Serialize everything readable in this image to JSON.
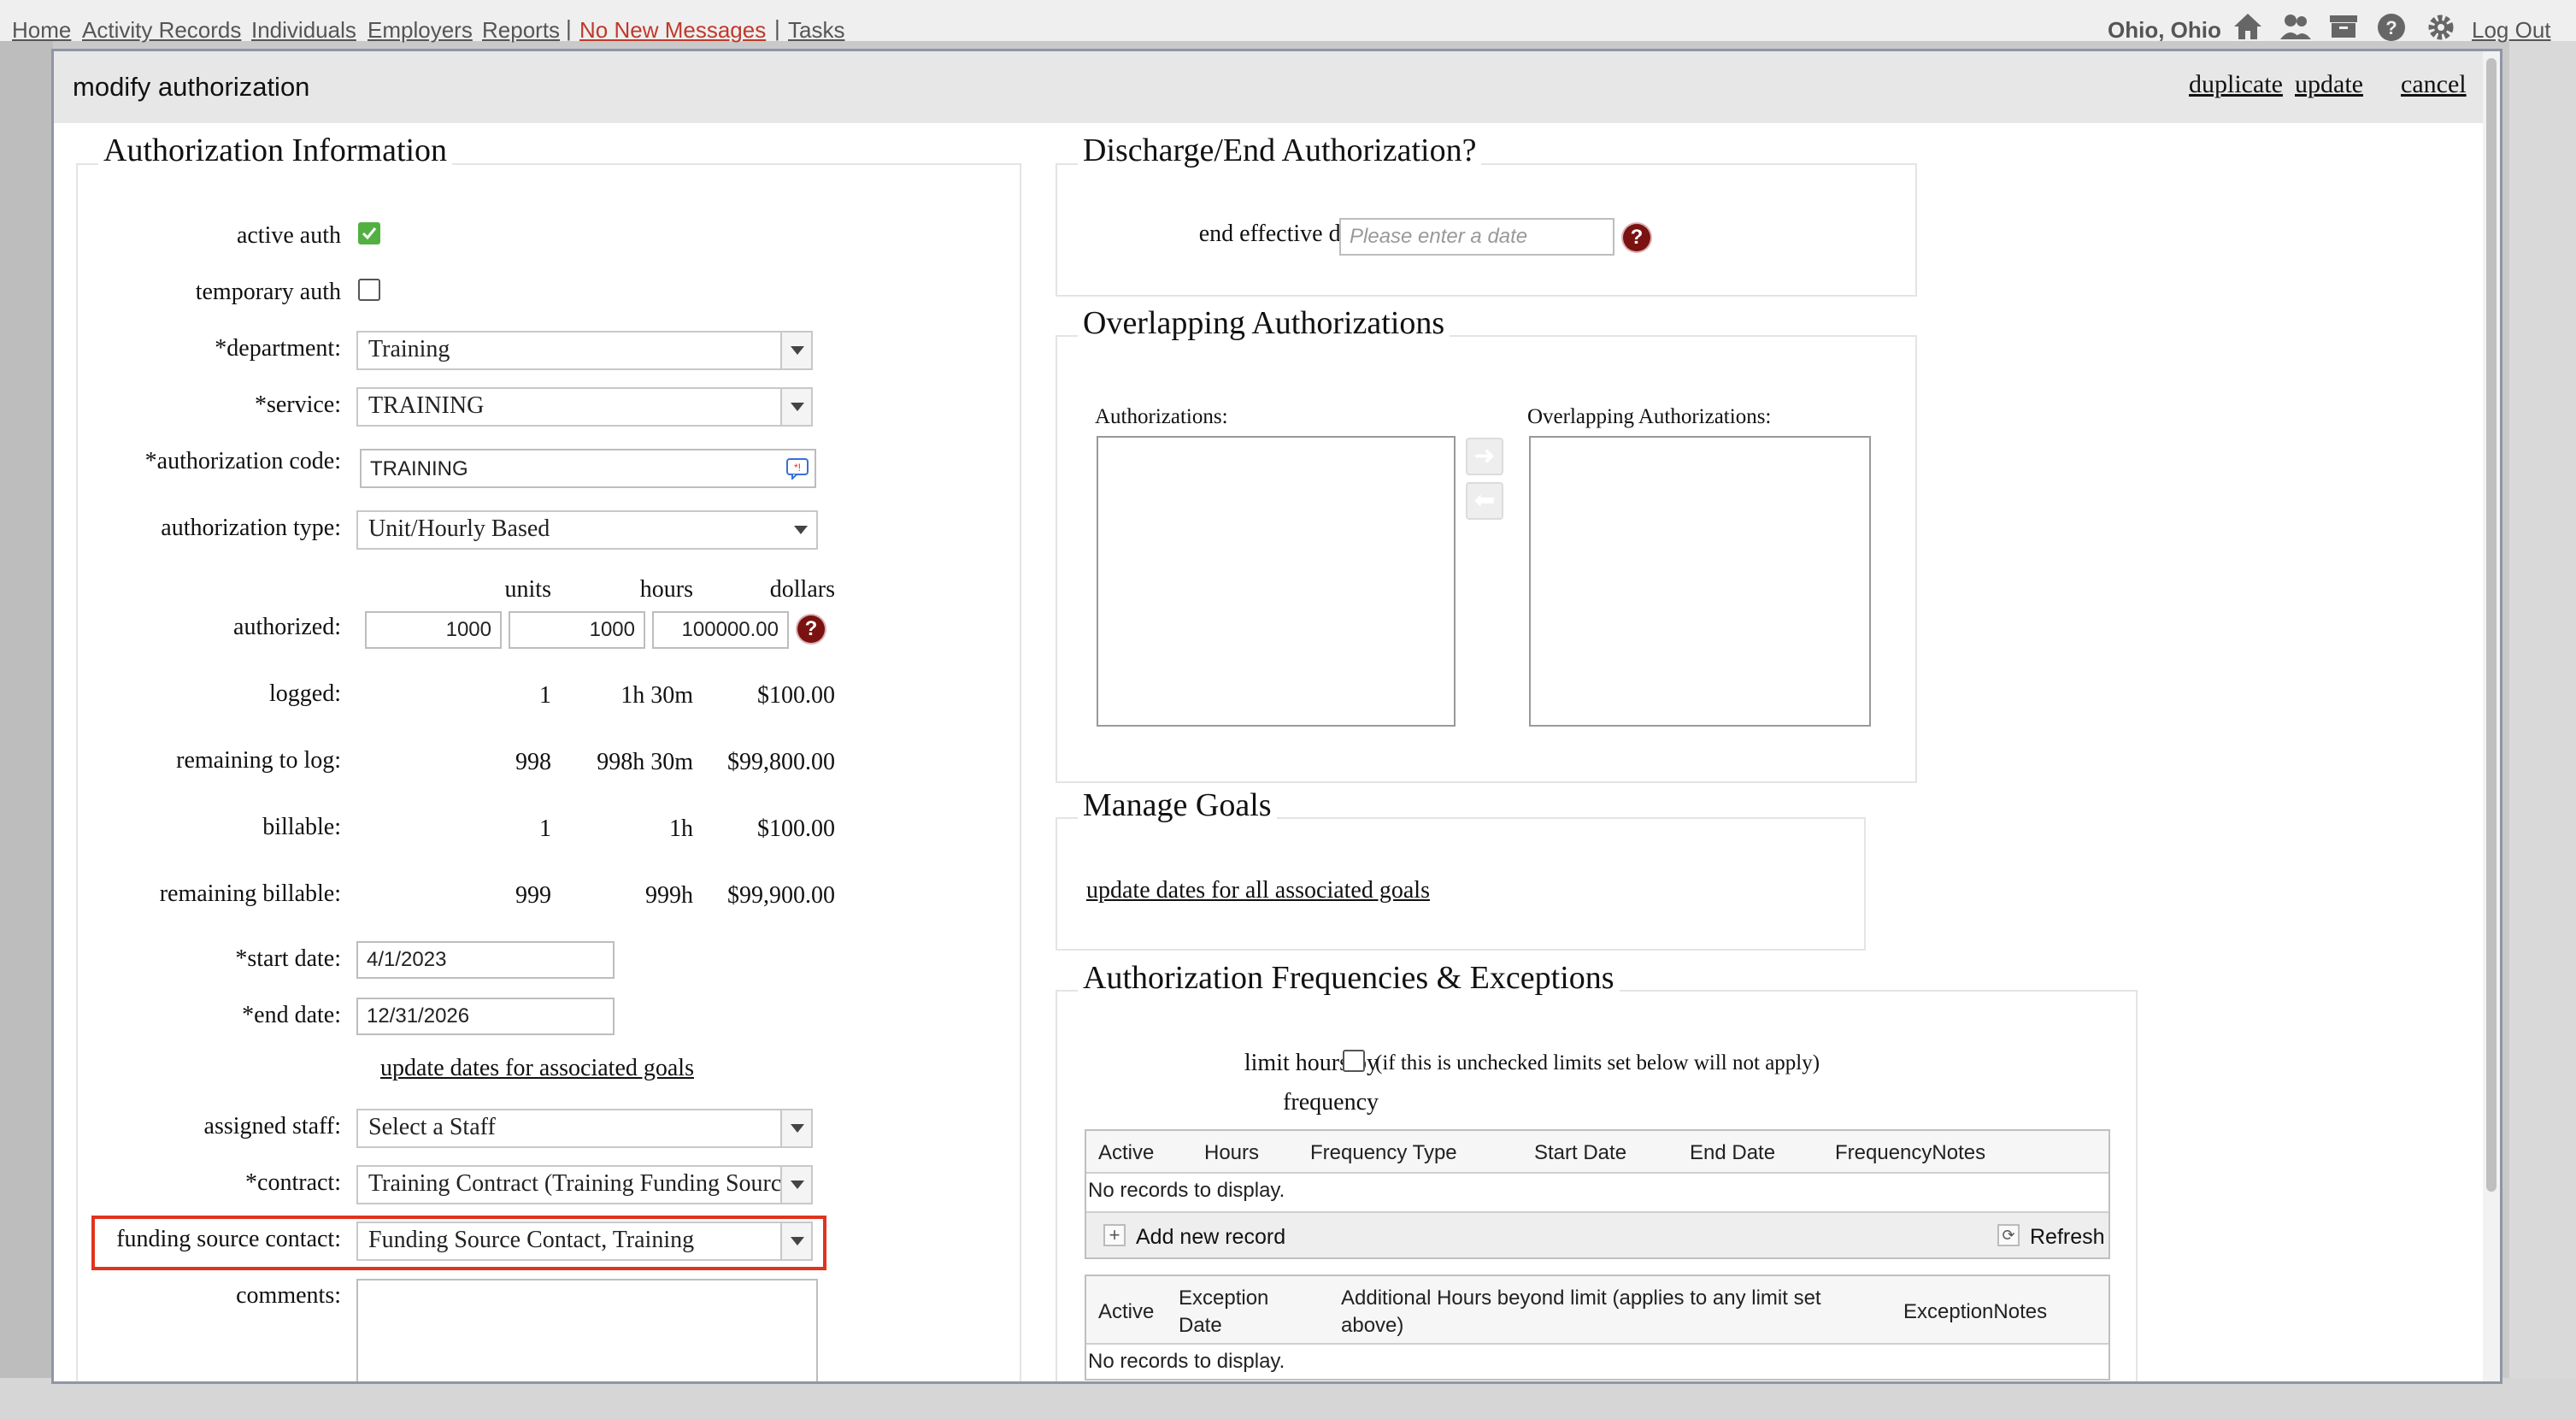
{
  "nav": {
    "items": [
      "Home",
      "Activity Records",
      "Individuals",
      "Employers",
      "Reports"
    ],
    "messages": "No New Messages",
    "tasks": "Tasks",
    "location": "Ohio, Ohio",
    "logout": "Log Out",
    "icons": [
      "home-icon",
      "users-icon",
      "archive-icon",
      "help-icon",
      "gear-icon"
    ],
    "accent_color": "#c0392b"
  },
  "modal": {
    "title": "modify authorization",
    "actions": {
      "duplicate": "duplicate",
      "update": "update",
      "cancel": "cancel"
    }
  },
  "auth_info": {
    "title": "Authorization Information",
    "active_auth": {
      "label": "active auth",
      "checked": true
    },
    "temporary_auth": {
      "label": "temporary auth",
      "checked": false
    },
    "department": {
      "label": "*department:",
      "value": "Training"
    },
    "service": {
      "label": "*service:",
      "value": "TRAINING"
    },
    "authorization_code": {
      "label": "*authorization code:",
      "value": "TRAINING"
    },
    "authorization_type": {
      "label": "authorization type:",
      "value": "Unit/Hourly Based"
    },
    "columns": [
      "units",
      "hours",
      "dollars"
    ],
    "authorized": {
      "label": "authorized:",
      "units": "1000",
      "hours": "1000",
      "dollars": "100000.00"
    },
    "logged": {
      "label": "logged:",
      "units": "1",
      "hours": "1h 30m",
      "dollars": "$100.00"
    },
    "remaining_to_log": {
      "label": "remaining to log:",
      "units": "998",
      "hours": "998h 30m",
      "dollars": "$99,800.00"
    },
    "billable": {
      "label": "billable:",
      "units": "1",
      "hours": "1h",
      "dollars": "$100.00"
    },
    "remaining_billable": {
      "label": "remaining billable:",
      "units": "999",
      "hours": "999h",
      "dollars": "$99,900.00"
    },
    "start_date": {
      "label": "*start date:",
      "value": "4/1/2023"
    },
    "end_date": {
      "label": "*end date:",
      "value": "12/31/2026"
    },
    "update_goals_link": "update dates for associated goals",
    "assigned_staff": {
      "label": "assigned staff:",
      "value": "Select a Staff"
    },
    "contract": {
      "label": "*contract:",
      "value": "Training Contract (Training Funding Source)"
    },
    "funding_source_contact": {
      "label": "funding source contact:",
      "value": "Funding Source Contact, Training"
    },
    "comments": {
      "label": "comments:",
      "value": ""
    }
  },
  "discharge": {
    "title": "Discharge/End Authorization?",
    "end_effective_label": "end effective date:",
    "end_effective_placeholder": "Please enter a date"
  },
  "overlapping": {
    "title": "Overlapping Authorizations",
    "left_label": "Authorizations:",
    "right_label": "Overlapping Authorizations:",
    "move_right": "➜",
    "move_left": "⬅"
  },
  "goals": {
    "title": "Manage Goals",
    "link": "update dates for all associated goals"
  },
  "frequencies": {
    "title": "Authorization Frequencies & Exceptions",
    "limit_label": "limit hours by",
    "limit_label_2": "frequency",
    "limit_note": "(if this is unchecked limits set below will not apply)",
    "limit_checked": false,
    "freq_grid": {
      "headers": [
        "Active",
        "Hours",
        "Frequency Type",
        "Start Date",
        "End Date",
        "FrequencyNotes"
      ],
      "empty": "No records to display.",
      "add_label": "Add new record",
      "refresh_label": "Refresh"
    },
    "exc_grid": {
      "headers": [
        "Active",
        "Exception",
        "Date",
        "Additional Hours beyond limit (applies to any limit set",
        "above)",
        "ExceptionNotes"
      ],
      "empty": "No records to display."
    }
  }
}
